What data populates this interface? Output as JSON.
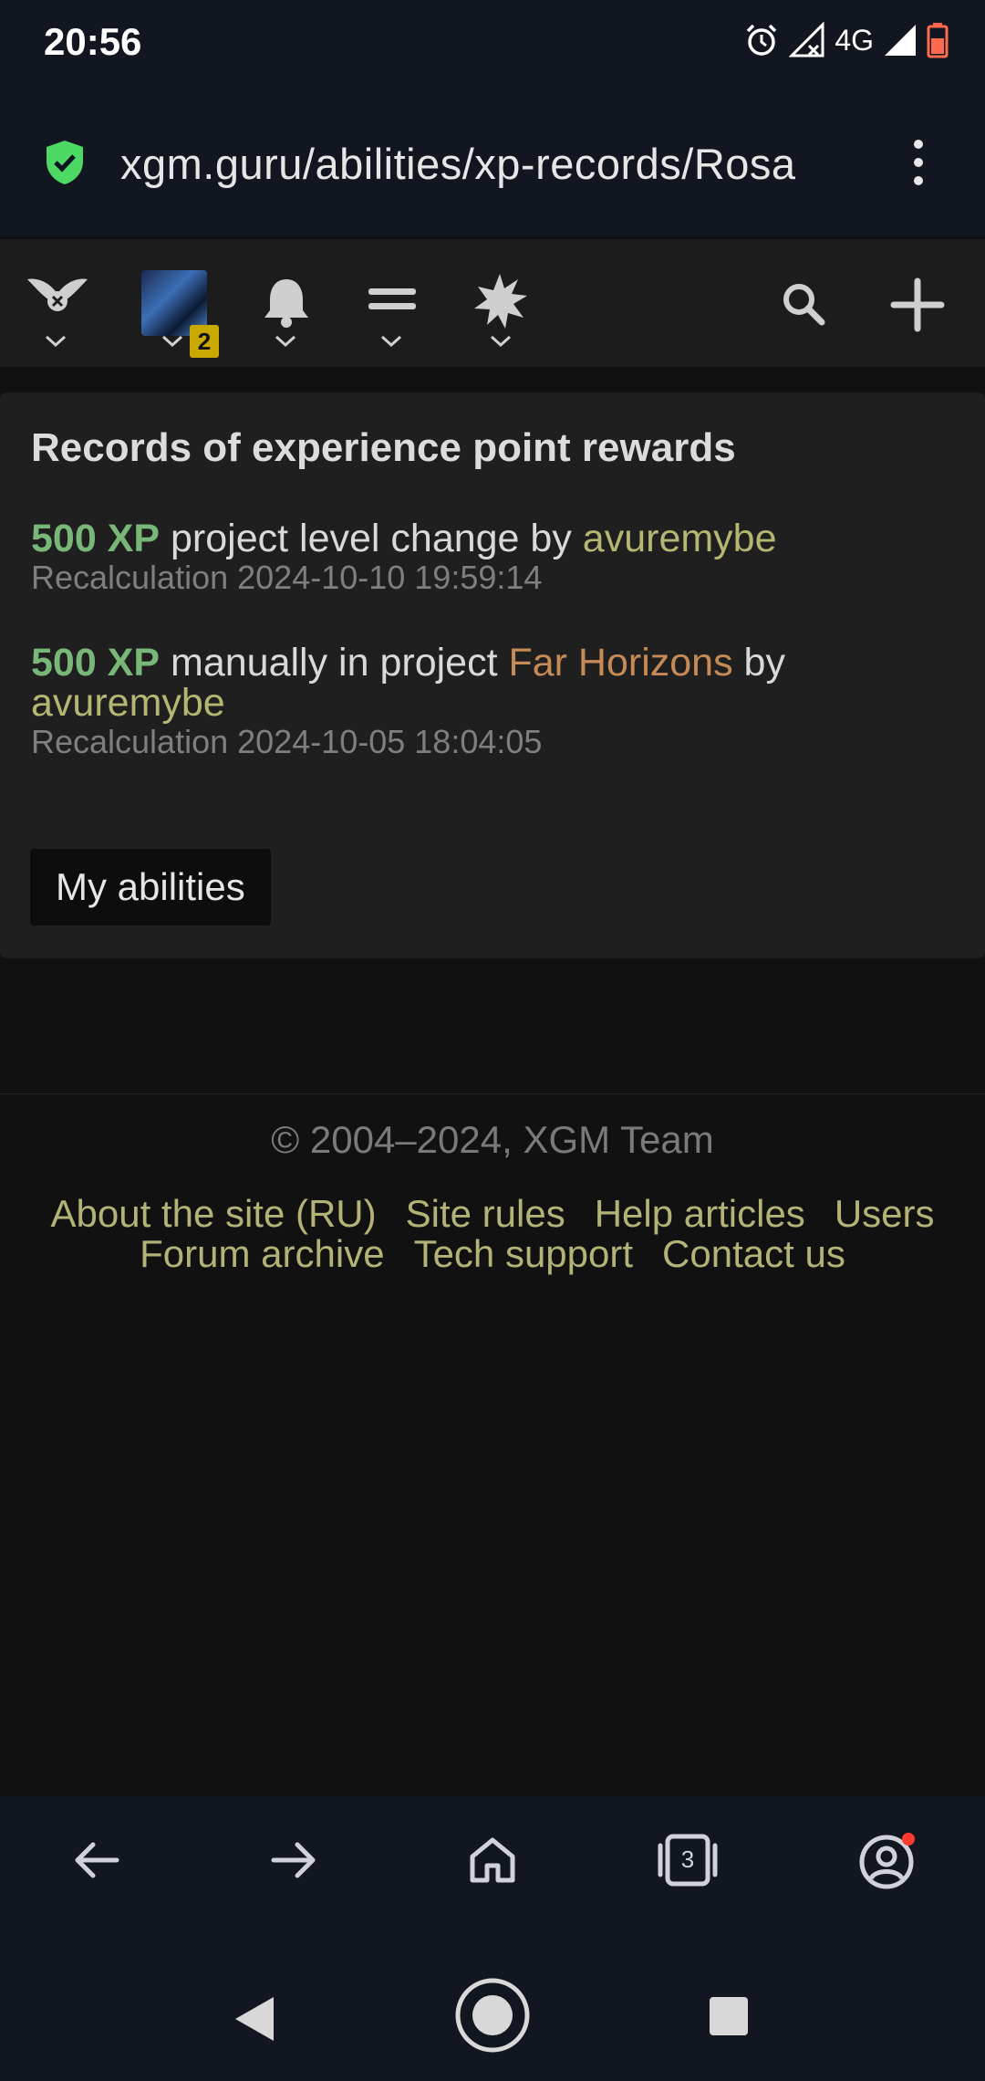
{
  "status_bar": {
    "time": "20:56",
    "network": "4G"
  },
  "url_bar": {
    "url": "xgm.guru/abilities/xp-records/Rosa",
    "shield_icon": "shield-check-icon",
    "menu_icon": "more-vert-icon"
  },
  "site_nav": {
    "notification_badge": "2",
    "icons": [
      "logo-icon",
      "avatar",
      "bell-icon",
      "menu-icon",
      "burst-icon",
      "search-icon",
      "plus-icon"
    ]
  },
  "records": {
    "title": "Records of experience point rewards",
    "items": [
      {
        "xp": "500 XP",
        "text1": " project level change by ",
        "user": "avuremybe",
        "meta": "Recalculation 2024-10-10 19:59:14"
      },
      {
        "xp": "500 XP",
        "text1": " manually in project ",
        "project": "Far Horizons",
        "text2": " by ",
        "user": "avuremybe",
        "meta": "Recalculation 2024-10-05 18:04:05"
      }
    ],
    "button_label": "My abilities"
  },
  "footer": {
    "copyright": "© 2004–2024, XGM Team",
    "links": [
      "About the site (RU)",
      "Site rules",
      "Help articles",
      "Users",
      "Forum archive",
      "Tech support",
      "Contact us"
    ]
  },
  "browser_bar": {
    "tabs_count": "3"
  },
  "colors": {
    "xp": "#78b778",
    "user": "#b5b672",
    "project": "#c58a55",
    "link": "#b3b378",
    "badge": "#c9a800"
  }
}
